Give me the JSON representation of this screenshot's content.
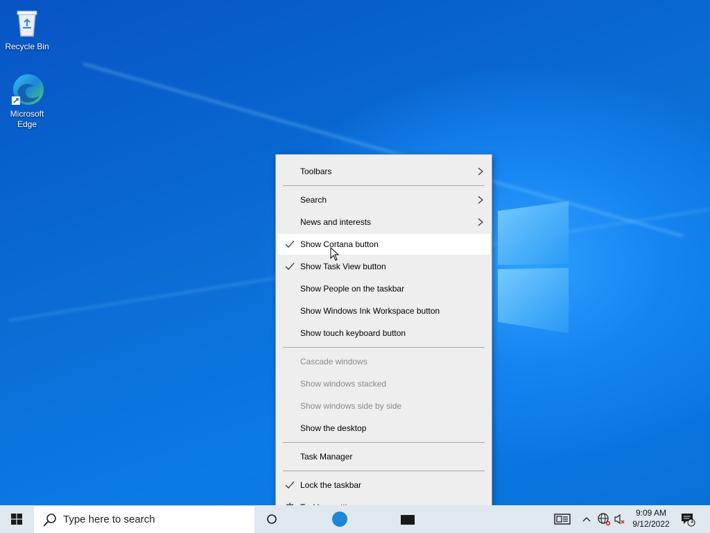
{
  "desktop": {
    "icons": [
      {
        "label": "Recycle Bin"
      },
      {
        "label": "Microsoft Edge"
      }
    ]
  },
  "context_menu": {
    "items": [
      {
        "label": "Toolbars",
        "submenu": true
      },
      {
        "label": "Search",
        "submenu": true
      },
      {
        "label": "News and interests",
        "submenu": true
      },
      {
        "label": "Show Cortana button",
        "checked": true,
        "highlighted": true
      },
      {
        "label": "Show Task View button",
        "checked": true
      },
      {
        "label": "Show People on the taskbar"
      },
      {
        "label": "Show Windows Ink Workspace button"
      },
      {
        "label": "Show touch keyboard button"
      },
      {
        "label": "Cascade windows",
        "disabled": true
      },
      {
        "label": "Show windows stacked",
        "disabled": true
      },
      {
        "label": "Show windows side by side",
        "disabled": true
      },
      {
        "label": "Show the desktop"
      },
      {
        "label": "Task Manager"
      },
      {
        "label": "Lock the taskbar",
        "checked": true
      },
      {
        "label": "Taskbar settings",
        "icon": "gear-icon"
      }
    ]
  },
  "taskbar": {
    "search_placeholder": "Type here to search",
    "clock": {
      "time": "9:09 AM",
      "date": "9/12/2022"
    },
    "notification_count": "1"
  },
  "colors": {
    "accent": "#0078d7",
    "menu_bg": "#eeeeee",
    "taskbar_bg": "#dfe7ef",
    "disabled_text": "#8a8a8a"
  }
}
